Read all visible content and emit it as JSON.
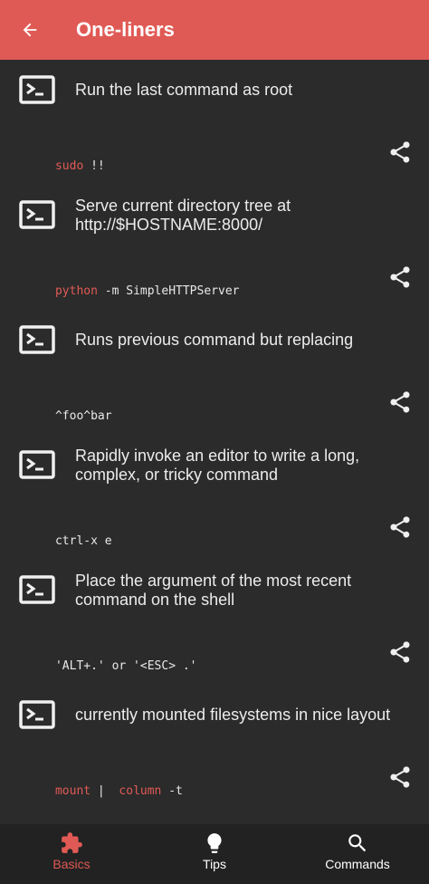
{
  "appbar": {
    "title": "One-liners"
  },
  "items": [
    {
      "desc": "Run the last command as root",
      "cmd": [
        {
          "text": "sudo",
          "kw": true
        },
        {
          "text": " !!",
          "kw": false
        }
      ]
    },
    {
      "desc": "Serve current directory tree at http://$HOSTNAME:8000/",
      "cmd": [
        {
          "text": "python",
          "kw": true
        },
        {
          "text": " -m SimpleHTTPServer",
          "kw": false
        }
      ]
    },
    {
      "desc": "Runs previous command but replacing",
      "cmd": [
        {
          "text": "^foo^bar",
          "kw": false
        }
      ]
    },
    {
      "desc": "Rapidly invoke an editor to write a long, complex, or tricky command",
      "cmd": [
        {
          "text": "ctrl-x e",
          "kw": false
        }
      ]
    },
    {
      "desc": "Place the argument of the most recent command on the shell",
      "cmd": [
        {
          "text": "'ALT+.' or '<ESC> .'",
          "kw": false
        }
      ]
    },
    {
      "desc": "currently mounted filesystems in nice layout",
      "cmd": [
        {
          "text": "mount",
          "kw": true
        },
        {
          "text": " |  ",
          "kw": false
        },
        {
          "text": "column",
          "kw": true
        },
        {
          "text": " -t",
          "kw": false
        }
      ]
    }
  ],
  "nav": {
    "basics": "Basics",
    "tips": "Tips",
    "commands": "Commands"
  },
  "colors": {
    "accent": "#e05a55",
    "background": "#2b2b2b",
    "navbar": "#222222"
  }
}
